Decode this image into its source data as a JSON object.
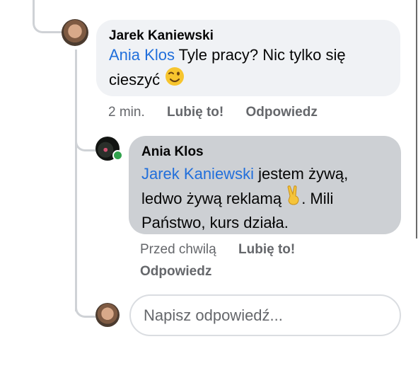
{
  "comments": [
    {
      "author": "Jarek Kaniewski",
      "mention": "Ania Klos",
      "text_line1": " Tyle pracy? Nic tylko się",
      "text_line2": "cieszyć",
      "emoji": "😉",
      "time": "2 min.",
      "like_label": "Lubię to!",
      "reply_label": "Odpowiedz"
    },
    {
      "author": "Ania Klos",
      "online": true,
      "mention": "Jarek Kaniewski",
      "text_after_mention": " jestem żywą,",
      "text_line2": "ledwo żywą reklamą",
      "emoji": "✌",
      "text_line2_end": ". Mili",
      "text_line3": "Państwo, kurs działa.",
      "time": "Przed chwilą",
      "like_label": "Lubię to!",
      "reply_label": "Odpowiedz"
    }
  ],
  "reply_input": {
    "placeholder": "Napisz odpowiedź..."
  },
  "colors": {
    "mention": "#216fdb",
    "bubble": "#f0f2f5",
    "bubble_selected": "#cdd0d4",
    "meta": "#65676b",
    "online": "#31a24c"
  }
}
